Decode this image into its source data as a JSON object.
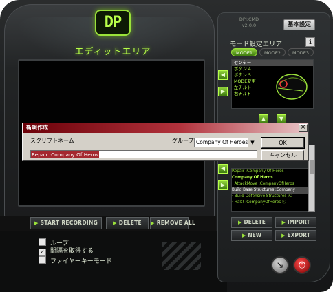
{
  "window": {
    "logo_text": "DP",
    "edit_area_title": "エディットエリア"
  },
  "left_actions": {
    "start_recording": "START RECORDING",
    "delete": "DELETE",
    "remove_all": "REMOVE ALL"
  },
  "options": [
    {
      "label": "ループ",
      "checked": false
    },
    {
      "label": "間隔を取得する",
      "checked": true
    },
    {
      "label": "ファイヤーキーモード",
      "checked": false
    }
  ],
  "right": {
    "dpi_line1": "DPI:CMD",
    "dpi_line2": "v2.0.0",
    "basic_settings": "基本設定",
    "mode_area_title": "モード設定エリア",
    "info_label": "i",
    "mode_tabs": [
      "MODE1",
      "MODE2",
      "MODE3"
    ],
    "active_mode": "MODE1",
    "assignments": [
      "センター",
      "ボタン 4",
      "ボタン 5",
      "MODE変更",
      "左チルト",
      "右チルト"
    ],
    "selected_assignment": "センター",
    "macro_list": [
      {
        "text": "Repair :Company Of Heros",
        "kind": "item"
      },
      {
        "text": "Company Of Heros",
        "kind": "group"
      },
      {
        "text": "· AttackMove :CompanyOfHeros",
        "kind": "item"
      },
      {
        "text": "Build Base Structures :Company",
        "kind": "sel"
      },
      {
        "text": "· Build Defensive Structures :C",
        "kind": "item"
      },
      {
        "text": "· Halt! :CompanyOfHeros ⓘ",
        "kind": "item"
      }
    ],
    "delete": "DELETE",
    "import": "IMPORT",
    "new": "NEW",
    "export": "EXPORT"
  },
  "dialog": {
    "title": "新規作成",
    "close": "×",
    "script_name_label": "スクリプトネーム",
    "group_label": "グループ",
    "group_value": "Company Of Heroes",
    "script_name_value": "Repair :Company Of Heros",
    "ok": "OK",
    "cancel": "キャンセル"
  },
  "colors": {
    "accent_green": "#9be23a",
    "dialog_title_red": "#a4282f",
    "chassis": "#1c1e1f"
  }
}
